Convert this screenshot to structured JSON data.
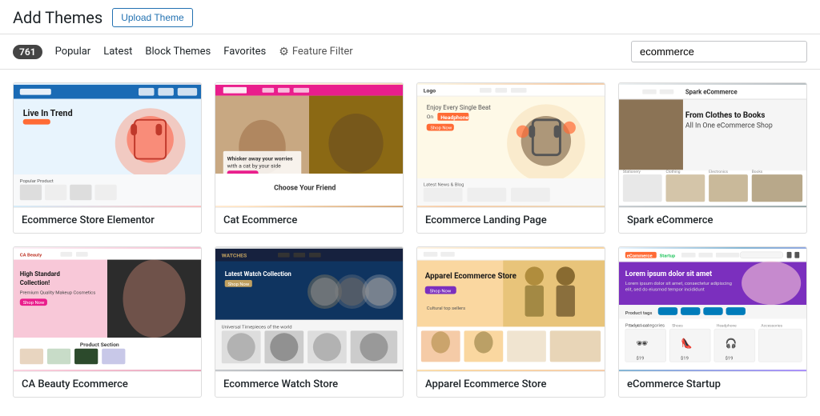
{
  "header": {
    "title": "Add Themes",
    "upload_button": "Upload Theme"
  },
  "filters": {
    "count": "761",
    "links": [
      "Popular",
      "Latest",
      "Block Themes",
      "Favorites"
    ],
    "feature_filter": "Feature Filter",
    "search_placeholder": "ecommerce",
    "search_value": "ecommerce"
  },
  "themes": [
    {
      "id": "theme-1",
      "name": "Ecommerce Store Elementor",
      "thumb_class": "thumb-1"
    },
    {
      "id": "theme-2",
      "name": "Cat Ecommerce",
      "thumb_class": "thumb-2"
    },
    {
      "id": "theme-3",
      "name": "Ecommerce Landing Page",
      "thumb_class": "thumb-3"
    },
    {
      "id": "theme-4",
      "name": "Spark eCommerce",
      "thumb_class": "thumb-4"
    },
    {
      "id": "theme-5",
      "name": "CA Beauty Ecommerce",
      "thumb_class": "thumb-5"
    },
    {
      "id": "theme-6",
      "name": "Ecommerce Watch Store",
      "thumb_class": "thumb-6"
    },
    {
      "id": "theme-7",
      "name": "Apparel Ecommerce Store",
      "thumb_class": "thumb-7"
    },
    {
      "id": "theme-8",
      "name": "eCommerce Startup",
      "thumb_class": "thumb-8"
    }
  ]
}
